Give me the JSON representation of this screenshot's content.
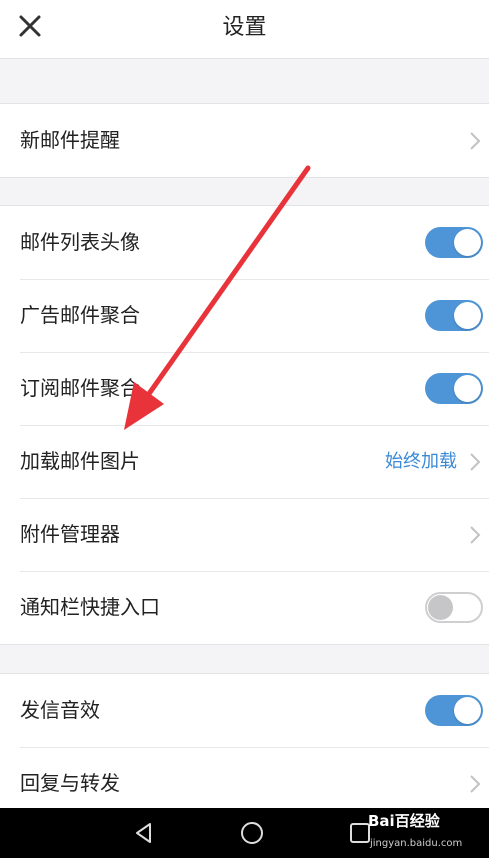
{
  "header": {
    "title": "设置"
  },
  "groups": [
    {
      "items": [
        {
          "label": "新邮件提醒",
          "type": "link"
        }
      ]
    },
    {
      "items": [
        {
          "label": "邮件列表头像",
          "type": "toggle",
          "on": true
        },
        {
          "label": "广告邮件聚合",
          "type": "toggle",
          "on": true
        },
        {
          "label": "订阅邮件聚合",
          "type": "toggle",
          "on": true
        },
        {
          "label": "加载邮件图片",
          "type": "link",
          "value": "始终加载"
        },
        {
          "label": "附件管理器",
          "type": "link"
        },
        {
          "label": "通知栏快捷入口",
          "type": "toggle",
          "on": false
        }
      ]
    },
    {
      "items": [
        {
          "label": "发信音效",
          "type": "toggle",
          "on": true
        },
        {
          "label": "回复与转发",
          "type": "link"
        }
      ]
    }
  ],
  "watermark": {
    "brand": "Bai百经验",
    "url": "jingyan.baidu.com"
  },
  "colors": {
    "toggle_on": "#4e95d8",
    "value_text": "#3a8ad6",
    "annotation_arrow": "#e8333a"
  }
}
